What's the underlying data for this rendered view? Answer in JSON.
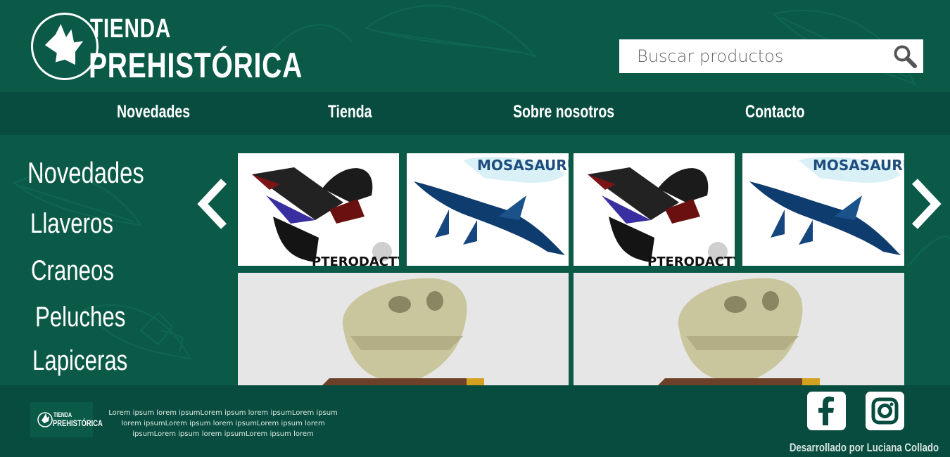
{
  "colors": {
    "background": "#0b5a48",
    "bar": "#074c3e",
    "text": "#ffffff"
  },
  "header": {
    "logo": {
      "line1": "TIENDA",
      "line2": "PREHISTÓRICA"
    },
    "search": {
      "placeholder": "Buscar productos",
      "icon": "search-icon"
    }
  },
  "nav": {
    "items": [
      "Novedades",
      "Tienda",
      "Sobre nosotros",
      "Contacto"
    ]
  },
  "sidebar": {
    "items": [
      "Novedades",
      "Llaveros",
      "Craneos",
      "Peluches",
      "Lapiceras"
    ]
  },
  "carousel": {
    "prev_icon": "chevron-left-icon",
    "next_icon": "chevron-right-icon",
    "tiles": [
      {
        "label": "PTERODACTYL",
        "kind": "pterodactyl"
      },
      {
        "label": "MOSASAURUS",
        "kind": "mosasaurus"
      },
      {
        "label": "PTERODACTYL",
        "kind": "pterodactyl"
      },
      {
        "label": "MOSASAURUS",
        "kind": "mosasaurus"
      },
      {
        "label": "",
        "kind": "trex-skull"
      },
      {
        "label": "",
        "kind": "trex-skull"
      }
    ]
  },
  "footer": {
    "logo": {
      "line1": "TIENDA",
      "line2": "PREHISTÓRICA"
    },
    "text": "Lorem ipsum lorem ipsumLorem ipsum lorem ipsumLorem ipsum lorem ipsumLorem ipsum lorem ipsumLorem ipsum lorem ipsumLorem ipsum lorem ipsumLorem ipsum lorem",
    "social": [
      "facebook-icon",
      "instagram-icon"
    ],
    "credit": "Desarrollado por Luciana Collado"
  }
}
